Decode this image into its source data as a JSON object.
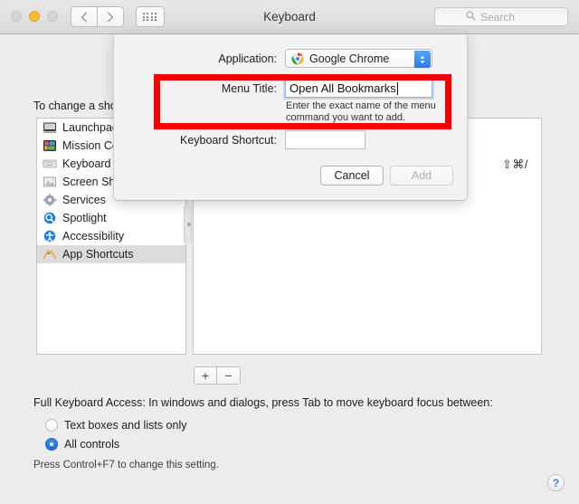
{
  "window": {
    "title": "Keyboard",
    "traffic_lights": [
      "close",
      "minimize",
      "zoom"
    ]
  },
  "toolbar": {
    "back_icon": "chevron-left-icon",
    "forward_icon": "chevron-right-icon",
    "grid_icon": "show-all-preferences-icon",
    "search": {
      "placeholder": "Search",
      "icon": "search-icon",
      "value": ""
    }
  },
  "main": {
    "help_text": "To change a shortcut, select it, click the key combination, and then type the new keys.",
    "categories": [
      {
        "label": "Launchpad & Dock",
        "icon": "launchpad-icon",
        "selected": false
      },
      {
        "label": "Mission Control",
        "icon": "mission-control-icon",
        "selected": false
      },
      {
        "label": "Keyboard",
        "icon": "keyboard-icon",
        "selected": false
      },
      {
        "label": "Screen Shots",
        "icon": "screenshot-icon",
        "selected": false
      },
      {
        "label": "Services",
        "icon": "services-gear-icon",
        "selected": false
      },
      {
        "label": "Spotlight",
        "icon": "spotlight-icon",
        "selected": false
      },
      {
        "label": "Accessibility",
        "icon": "accessibility-icon",
        "selected": false
      },
      {
        "label": "App Shortcuts",
        "icon": "app-shortcuts-icon",
        "selected": true
      }
    ],
    "shortcut_value": "⇧⌘/",
    "add_button_label": "+",
    "remove_button_label": "−",
    "full_keyboard_access": {
      "description": "Full Keyboard Access: In windows and dialogs, press Tab to move keyboard focus between:",
      "options": [
        {
          "label": "Text boxes and lists only",
          "selected": false
        },
        {
          "label": "All controls",
          "selected": true
        }
      ],
      "note": "Press Control+F7 to change this setting."
    },
    "help_button_label": "?"
  },
  "sheet": {
    "application_label": "Application:",
    "application_value": "Google Chrome",
    "application_icon": "chrome-icon",
    "application_chevron_icon": "updown-chevron-icon",
    "menu_title_label": "Menu Title:",
    "menu_title_value": "Open All Bookmarks",
    "menu_title_hint": "Enter the exact name of the menu command you want to add.",
    "keyboard_shortcut_label": "Keyboard Shortcut:",
    "keyboard_shortcut_value": "",
    "cancel_label": "Cancel",
    "add_label": "Add"
  },
  "annotation": {
    "highlight_color": "#f60000",
    "target": "menu-title-row"
  }
}
